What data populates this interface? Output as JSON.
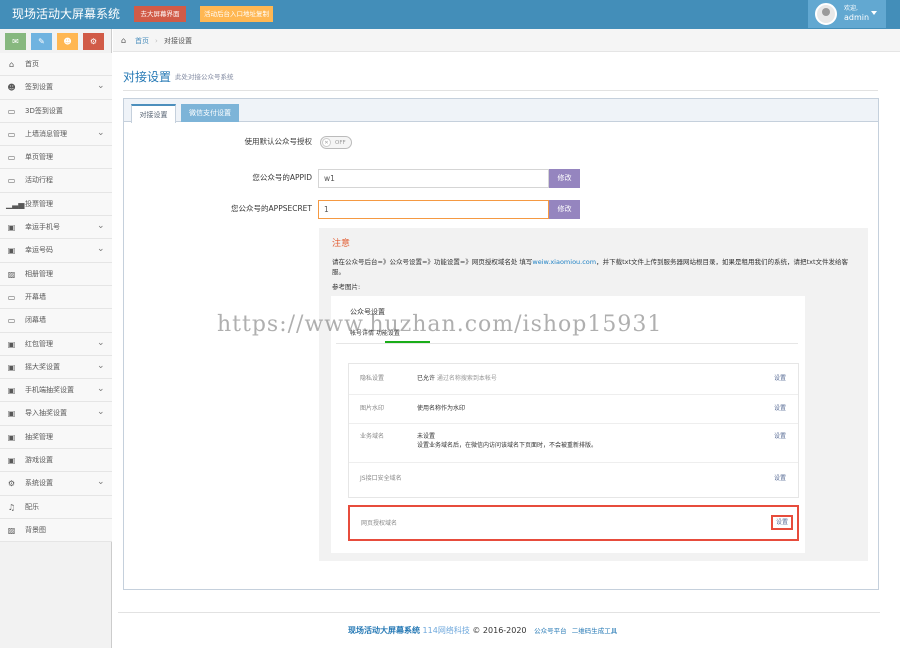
{
  "header": {
    "brand": "现场活动大屏幕系统",
    "btn_screen": "去大屏幕界面",
    "btn_login": "活动后台入口地址复制",
    "user_greeting": "欢迎,",
    "user_name": "admin",
    "colors": {
      "bar": "#438eb9",
      "btn_screen": "#d15b47",
      "btn_login": "#ffb752"
    }
  },
  "shortcuts": [
    {
      "icon": "comment-icon",
      "glyph": "✉",
      "color": "#87b87f"
    },
    {
      "icon": "pencil-icon",
      "glyph": "✎",
      "color": "#6fb3e0"
    },
    {
      "icon": "users-icon",
      "glyph": "☻",
      "color": "#ffb752"
    },
    {
      "icon": "cogs-icon",
      "glyph": "⚙",
      "color": "#d15b47"
    }
  ],
  "sidebar": {
    "items": [
      {
        "label": "首页",
        "glyph": "⌂",
        "icon": "home-icon",
        "arrow": false
      },
      {
        "label": "签到设置",
        "glyph": "☻",
        "icon": "users-icon",
        "arrow": true
      },
      {
        "label": "3D签到设置",
        "glyph": "▭",
        "icon": "desktop-icon",
        "arrow": false
      },
      {
        "label": "上墙消息管理",
        "glyph": "▭",
        "icon": "desktop-icon",
        "arrow": true
      },
      {
        "label": "单页管理",
        "glyph": "▭",
        "icon": "desktop-icon",
        "arrow": false
      },
      {
        "label": "活动行程",
        "glyph": "▭",
        "icon": "desktop-icon",
        "arrow": false
      },
      {
        "label": "投票管理",
        "glyph": "▁▃▅",
        "icon": "signal-icon",
        "arrow": false
      },
      {
        "label": "幸运手机号",
        "glyph": "▣",
        "icon": "gift-icon",
        "arrow": true
      },
      {
        "label": "幸运号码",
        "glyph": "▣",
        "icon": "gift-icon",
        "arrow": true
      },
      {
        "label": "相册管理",
        "glyph": "▨",
        "icon": "picture-icon",
        "arrow": false
      },
      {
        "label": "开幕墙",
        "glyph": "▭",
        "icon": "desktop-icon",
        "arrow": false
      },
      {
        "label": "闭幕墙",
        "glyph": "▭",
        "icon": "desktop-icon",
        "arrow": false
      },
      {
        "label": "红包管理",
        "glyph": "▣",
        "icon": "gift-icon",
        "arrow": true
      },
      {
        "label": "摇大奖设置",
        "glyph": "▣",
        "icon": "gift-icon",
        "arrow": true
      },
      {
        "label": "手机端抽奖设置",
        "glyph": "▣",
        "icon": "gift-icon",
        "arrow": true
      },
      {
        "label": "导入抽奖设置",
        "glyph": "▣",
        "icon": "gift-icon",
        "arrow": true
      },
      {
        "label": "抽奖管理",
        "glyph": "▣",
        "icon": "gift-icon",
        "arrow": false
      },
      {
        "label": "游戏设置",
        "glyph": "▣",
        "icon": "gift-icon",
        "arrow": false
      },
      {
        "label": "系统设置",
        "glyph": "⚙",
        "icon": "gear-icon",
        "arrow": true
      },
      {
        "label": "配乐",
        "glyph": "♫",
        "icon": "music-icon",
        "arrow": false
      },
      {
        "label": "背景图",
        "glyph": "▨",
        "icon": "picture-icon",
        "arrow": false
      }
    ]
  },
  "breadcrumb": {
    "home": "首页",
    "current": "对接设置"
  },
  "page": {
    "title": "对接设置",
    "subtitle": "此处对接公众号系统"
  },
  "tabs": {
    "active": "对接设置",
    "inactive": "微信支付设置"
  },
  "form": {
    "default_auth_label": "使用默认公众号授权",
    "toggle_text": "OFF",
    "appid_label": "您公众号的APPID",
    "appid_value": "w1",
    "secret_label": "您公众号的APPSECRET",
    "secret_value": "1",
    "edit_label": "修改"
  },
  "notice": {
    "title": "注意",
    "text_before": "请在公众号后台=》公众号设置=》功能设置=》网页授权域名处 填写",
    "domain": "weiw.xiaomiou.com",
    "text_after": "，并下载txt文件上传到服务器网站根目录，如果是租用我们的系统，请把txt文件发给客服。",
    "ref_label": "参考图片:"
  },
  "screenshot": {
    "title": "公众号设置",
    "tabs": "帐号详情     功能设置",
    "rows": [
      {
        "key": "隐私设置",
        "value": "已允许",
        "note": " 通过名称搜索到本帐号",
        "action": "设置"
      },
      {
        "key": "图片水印",
        "value": "使用名称作为水印",
        "note": "",
        "action": "设置"
      },
      {
        "key": "业务域名",
        "value": "未设置",
        "note": "设置业务域名后，在微信内访问该域名下页面时，不会被重新排版。",
        "action": "设置"
      },
      {
        "key": "JS接口安全域名",
        "value": "",
        "note": "",
        "action": "设置"
      }
    ],
    "highlight_key": "网页授权域名",
    "highlight_action": "设置"
  },
  "watermark": "https://www.huzhan.com/ishop15931",
  "footer": {
    "brand": "现场活动大屏幕系统",
    "company": "114网络科技",
    "copyright": "© 2016-2020",
    "link1": "公众号平台",
    "link2": "二维码生成工具"
  }
}
